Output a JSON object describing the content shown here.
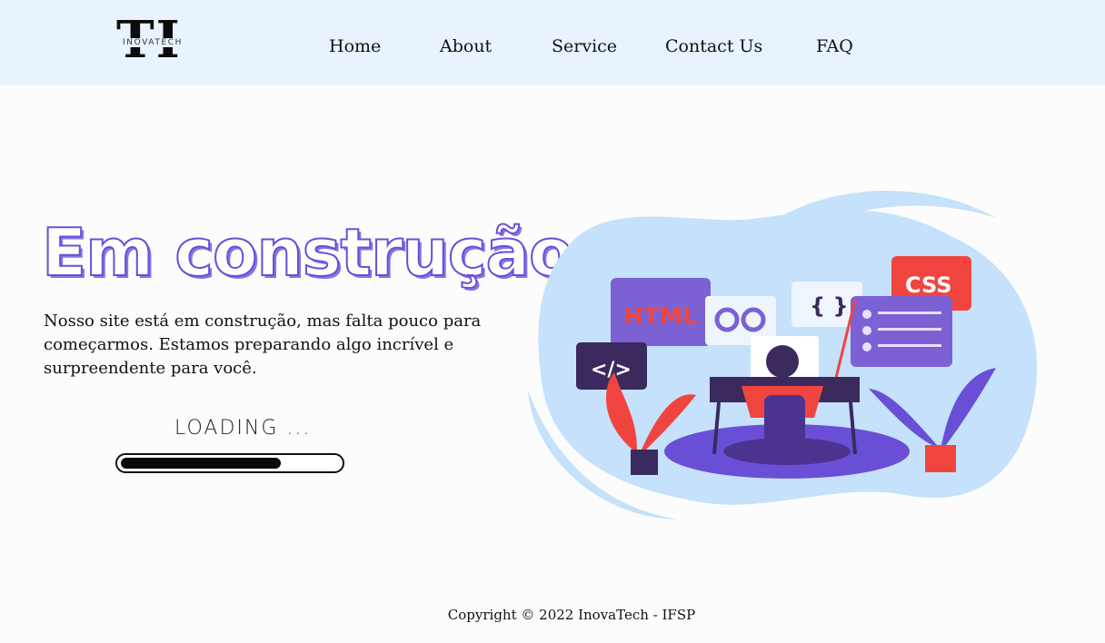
{
  "header": {
    "logo": {
      "letters": "TI",
      "name": "INOVATECH"
    },
    "nav": [
      {
        "label": "Home"
      },
      {
        "label": "About"
      },
      {
        "label": "Service"
      },
      {
        "label": "Contact Us"
      },
      {
        "label": "FAQ"
      }
    ]
  },
  "hero": {
    "title": "Em construção",
    "description": "Nosso site está em construção, mas falta pouco para começarmos. Estamos preparando algo incrível e surpreendente para você.",
    "loading_label": "LOADING ...",
    "loading_progress_percent": 72,
    "illustration": {
      "html_label": "HTML",
      "css_label": "CSS",
      "code_label": "</>",
      "braces_label": "{ }"
    }
  },
  "footer": {
    "copyright": "Copyright © 2022 InovaTech - IFSP"
  },
  "colors": {
    "header_bg": "#e8f3fe",
    "title_outline": "#6a4fd6",
    "illus_blue": "#c5e1fb",
    "css_red": "#f0453f",
    "html_purple": "#7b61d4"
  }
}
